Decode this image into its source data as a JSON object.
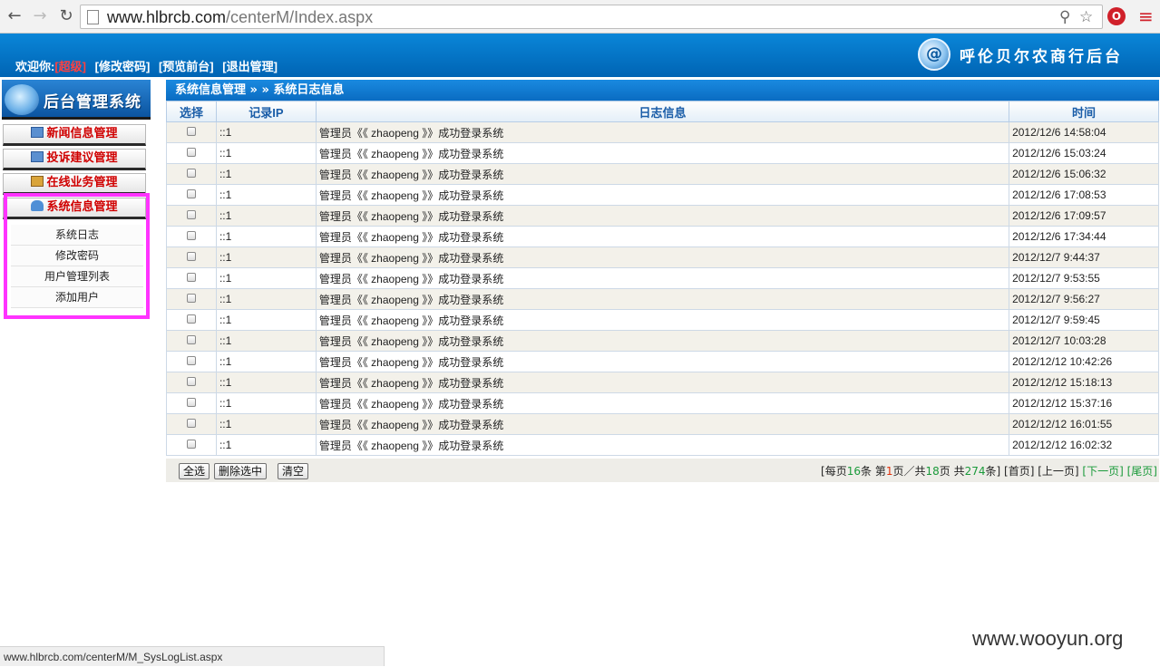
{
  "browser": {
    "url_host": "www.hlbrcb.com",
    "url_path": "/centerM/Index.aspx",
    "status_url": "www.hlbrcb.com/centerM/M_SysLogList.aspx"
  },
  "header": {
    "welcome_label": "欢迎你:",
    "username": "[超级]",
    "change_password": "[修改密码]",
    "preview_site": "[预览前台]",
    "logout": "[退出管理]",
    "brand_title": "呼伦贝尔农商行后台"
  },
  "sidebar": {
    "logo_text": "后台管理系统",
    "menus": [
      {
        "label": "新闻信息管理"
      },
      {
        "label": "投诉建议管理"
      },
      {
        "label": "在线业务管理"
      },
      {
        "label": "系统信息管理"
      }
    ],
    "submenu": [
      {
        "label": "系统日志"
      },
      {
        "label": "修改密码"
      },
      {
        "label": "用户管理列表"
      },
      {
        "label": "添加用户"
      }
    ]
  },
  "content": {
    "breadcrumb": "系统信息管理 » » 系统日志信息",
    "columns": [
      "选择",
      "记录IP",
      "日志信息",
      "时间"
    ],
    "rows": [
      {
        "ip": "::1",
        "msg": "管理员《《 zhaopeng 》》成功登录系统",
        "time": "2012/12/6 14:58:04"
      },
      {
        "ip": "::1",
        "msg": "管理员《《 zhaopeng 》》成功登录系统",
        "time": "2012/12/6 15:03:24"
      },
      {
        "ip": "::1",
        "msg": "管理员《《 zhaopeng 》》成功登录系统",
        "time": "2012/12/6 15:06:32"
      },
      {
        "ip": "::1",
        "msg": "管理员《《 zhaopeng 》》成功登录系统",
        "time": "2012/12/6 17:08:53"
      },
      {
        "ip": "::1",
        "msg": "管理员《《 zhaopeng 》》成功登录系统",
        "time": "2012/12/6 17:09:57"
      },
      {
        "ip": "::1",
        "msg": "管理员《《 zhaopeng 》》成功登录系统",
        "time": "2012/12/6 17:34:44"
      },
      {
        "ip": "::1",
        "msg": "管理员《《 zhaopeng 》》成功登录系统",
        "time": "2012/12/7 9:44:37"
      },
      {
        "ip": "::1",
        "msg": "管理员《《 zhaopeng 》》成功登录系统",
        "time": "2012/12/7 9:53:55"
      },
      {
        "ip": "::1",
        "msg": "管理员《《 zhaopeng 》》成功登录系统",
        "time": "2012/12/7 9:56:27"
      },
      {
        "ip": "::1",
        "msg": "管理员《《 zhaopeng 》》成功登录系统",
        "time": "2012/12/7 9:59:45"
      },
      {
        "ip": "::1",
        "msg": "管理员《《 zhaopeng 》》成功登录系统",
        "time": "2012/12/7 10:03:28"
      },
      {
        "ip": "::1",
        "msg": "管理员《《 zhaopeng 》》成功登录系统",
        "time": "2012/12/12 10:42:26"
      },
      {
        "ip": "::1",
        "msg": "管理员《《 zhaopeng 》》成功登录系统",
        "time": "2012/12/12 15:18:13"
      },
      {
        "ip": "::1",
        "msg": "管理员《《 zhaopeng 》》成功登录系统",
        "time": "2012/12/12 15:37:16"
      },
      {
        "ip": "::1",
        "msg": "管理员《《 zhaopeng 》》成功登录系统",
        "time": "2012/12/12 16:01:55"
      },
      {
        "ip": "::1",
        "msg": "管理员《《 zhaopeng 》》成功登录系统",
        "time": "2012/12/12 16:02:32"
      }
    ],
    "buttons": {
      "select_all": "全选",
      "delete_selected": "删除选中",
      "clear": "清空"
    },
    "pager": {
      "prefix": "[每页",
      "per_page": "16",
      "mid1": "条 第",
      "current_page": "1",
      "mid2": "页／共",
      "total_pages": "18",
      "mid3": "页 共",
      "total_records": "274",
      "suffix": "条]",
      "first": "[首页]",
      "prev": "[上一页]",
      "next": "[下一页]",
      "last": "[尾页]"
    }
  },
  "watermark": "www.wooyun.org"
}
